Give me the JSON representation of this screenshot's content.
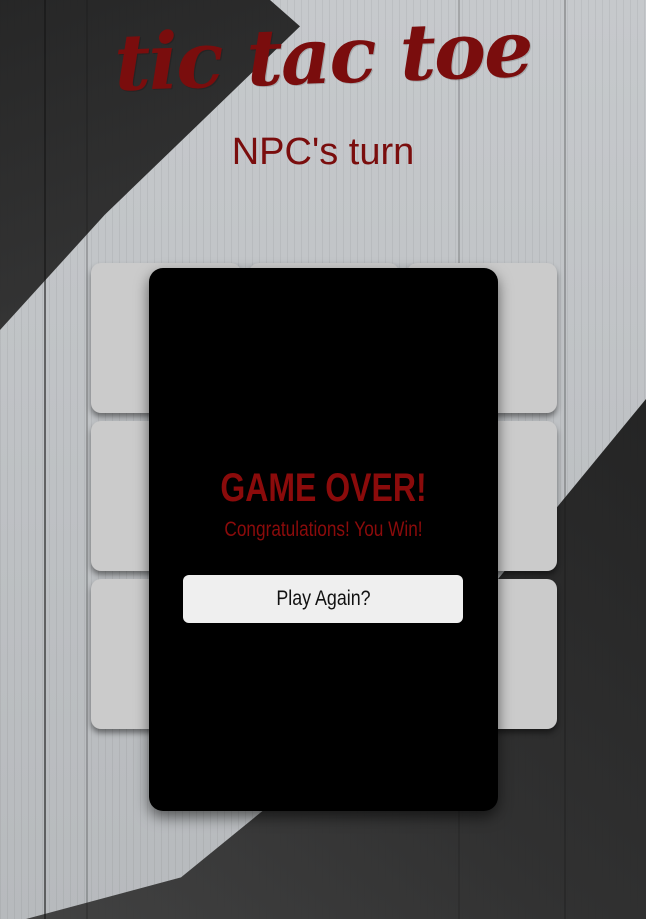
{
  "header": {
    "title": "tic tac toe",
    "turn_status": "NPC's turn"
  },
  "board": {
    "cells": [
      "",
      "",
      "",
      "",
      "",
      "",
      "",
      "",
      ""
    ]
  },
  "modal": {
    "title": "GAME OVER!",
    "message": "Congratulations! You Win!",
    "play_again_label": "Play Again?"
  },
  "colors": {
    "accent": "#7a0d0d",
    "modal_bg": "#000000",
    "cell_bg": "#cbcbcb",
    "button_bg": "#efefef"
  }
}
